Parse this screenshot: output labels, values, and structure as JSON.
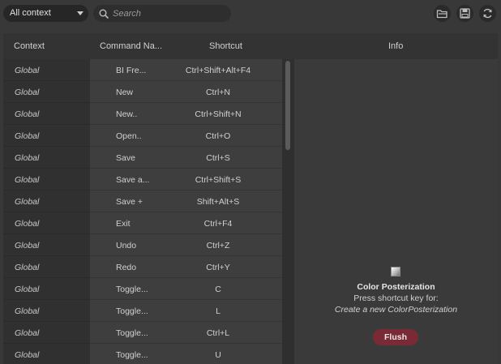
{
  "toolbar": {
    "context_select": "All context",
    "search_placeholder": "Search",
    "buttons": [
      "folder-open-icon",
      "save-icon",
      "refresh-icon"
    ]
  },
  "table": {
    "columns": {
      "context": "Context",
      "command": "Command Na...",
      "shortcut": "Shortcut",
      "info": "Info"
    },
    "rows": [
      {
        "context": "Global",
        "command": "BI Fre...",
        "shortcut": "Ctrl+Shift+Alt+F4"
      },
      {
        "context": "Global",
        "command": "New",
        "shortcut": "Ctrl+N"
      },
      {
        "context": "Global",
        "command": "New..",
        "shortcut": "Ctrl+Shift+N"
      },
      {
        "context": "Global",
        "command": "Open..",
        "shortcut": "Ctrl+O"
      },
      {
        "context": "Global",
        "command": "Save",
        "shortcut": "Ctrl+S"
      },
      {
        "context": "Global",
        "command": "Save a...",
        "shortcut": "Ctrl+Shift+S"
      },
      {
        "context": "Global",
        "command": "Save +",
        "shortcut": "Shift+Alt+S"
      },
      {
        "context": "Global",
        "command": "Exit",
        "shortcut": "Ctrl+F4"
      },
      {
        "context": "Global",
        "command": "Undo",
        "shortcut": "Ctrl+Z"
      },
      {
        "context": "Global",
        "command": "Redo",
        "shortcut": "Ctrl+Y"
      },
      {
        "context": "Global",
        "command": "Toggle...",
        "shortcut": "C"
      },
      {
        "context": "Global",
        "command": "Toggle...",
        "shortcut": "L"
      },
      {
        "context": "Global",
        "command": "Toggle...",
        "shortcut": "Ctrl+L"
      },
      {
        "context": "Global",
        "command": "Toggle...",
        "shortcut": "U"
      }
    ]
  },
  "info": {
    "title": "Color Posterization",
    "prompt": "Press shortcut key for:",
    "description": "Create a new ColorPosterization",
    "flush_label": "Flush"
  },
  "colors": {
    "background": "#383838",
    "flush_button": "#7a2a34",
    "context_cell": "#303030",
    "row_cell": "#3e3e3e"
  }
}
